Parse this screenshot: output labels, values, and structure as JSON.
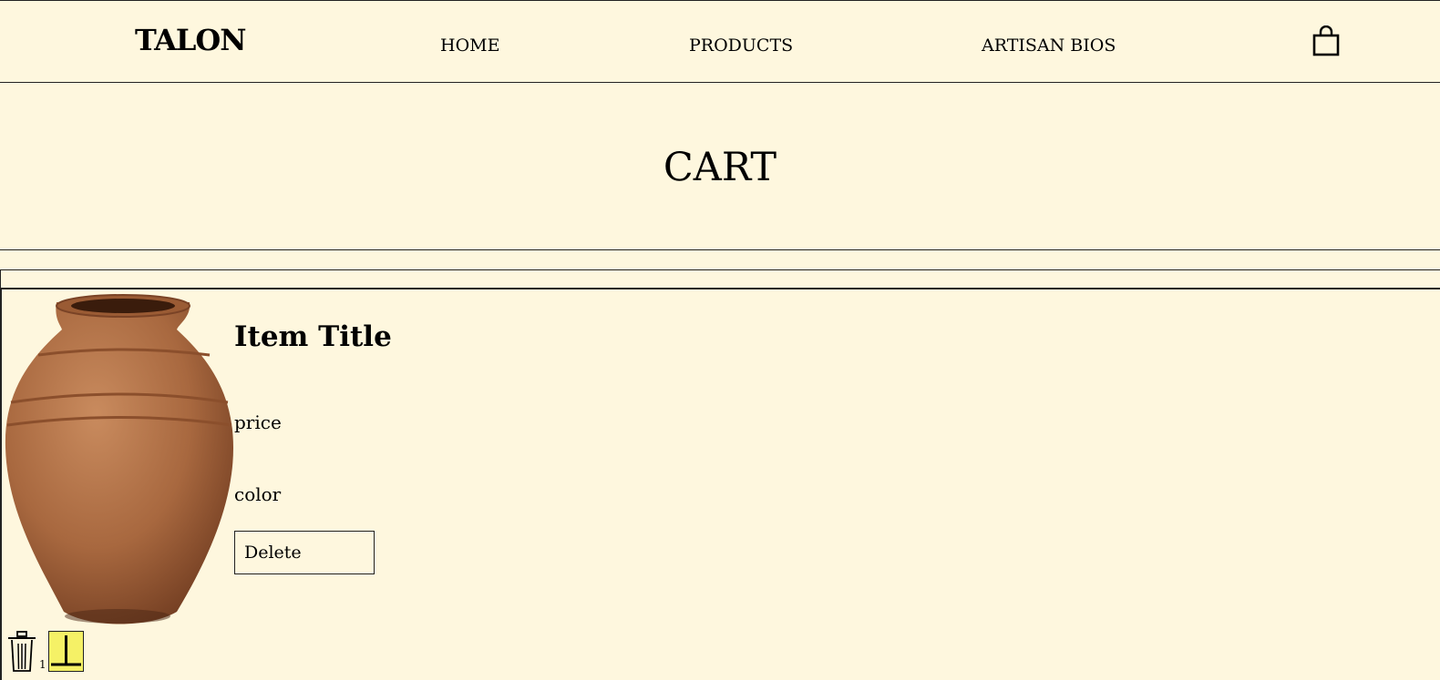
{
  "header": {
    "logo": "TALON",
    "nav": [
      {
        "label": "HOME"
      },
      {
        "label": "PRODUCTS"
      },
      {
        "label": "ARTISAN BIOS"
      }
    ],
    "cart_icon": "shopping-bag-icon"
  },
  "page": {
    "title": "CART"
  },
  "item": {
    "image": "clay-pot-image",
    "title": "Item Title",
    "price": "price",
    "color": "color",
    "delete_label": "Delete",
    "trash_icon": "trash-icon",
    "quantity": "1",
    "quantity_control_icon": "quantity-stepper-icon",
    "quantity_control_color": "#f5f166"
  },
  "colors": {
    "background": "#fef7de",
    "text": "#000000",
    "border": "#222222"
  }
}
